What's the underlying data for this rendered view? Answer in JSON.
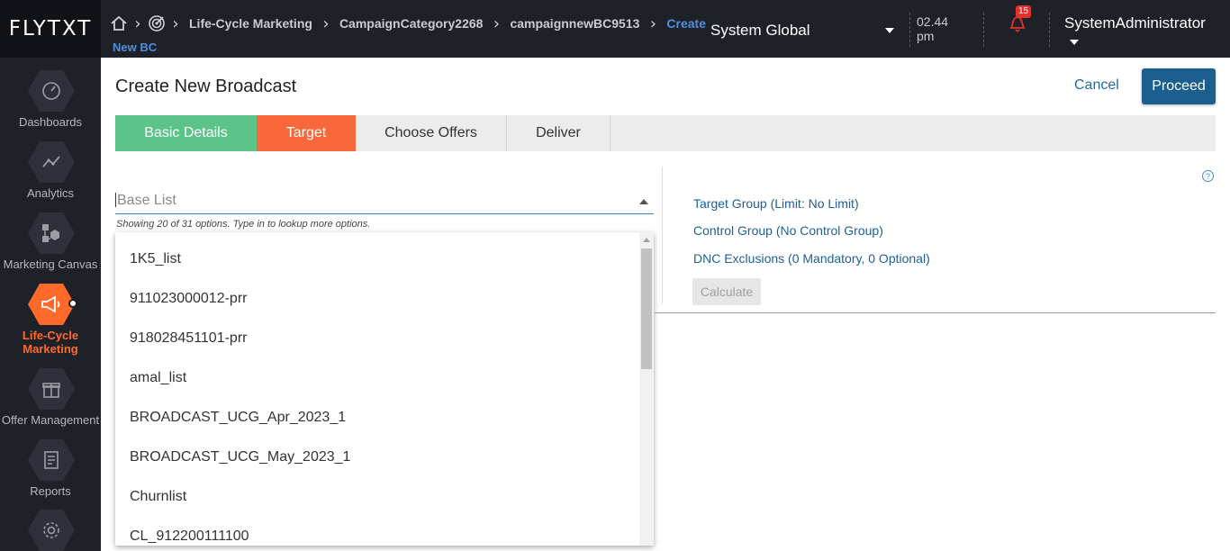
{
  "header": {
    "logo": "FLYTXT",
    "breadcrumb": [
      "Life-Cycle Marketing",
      "CampaignCategory2268",
      "campaignnewBC9513",
      "Create"
    ],
    "breadcrumb_sub": "New BC",
    "org": "System Global",
    "time": "02.44",
    "time_suffix": "pm",
    "notifications": "15",
    "user": "SystemAdministrator",
    "icons": [
      "home-icon",
      "target-icon",
      "bell-icon"
    ]
  },
  "sidebar": {
    "items": [
      {
        "label": "Dashboards",
        "icon": "gauge-icon"
      },
      {
        "label": "Analytics",
        "icon": "line-chart-icon"
      },
      {
        "label": "Marketing Canvas",
        "icon": "flow-icon"
      },
      {
        "label": "Life-Cycle Marketing",
        "line1": "Life-Cycle",
        "line2": "Marketing",
        "icon": "megaphone-icon",
        "active": true
      },
      {
        "label": "Offer Management",
        "icon": "gift-icon"
      },
      {
        "label": "Reports",
        "icon": "report-icon"
      },
      {
        "label": "",
        "icon": "gear-icon"
      }
    ]
  },
  "main": {
    "title": "Create New Broadcast",
    "cancel_label": "Cancel",
    "proceed_label": "Proceed",
    "tabs": [
      {
        "label": "Basic Details",
        "state": "done"
      },
      {
        "label": "Target",
        "state": "current"
      },
      {
        "label": "Choose Offers",
        "state": "todo"
      },
      {
        "label": "Deliver",
        "state": "todo"
      }
    ],
    "base_list": {
      "placeholder": "Base List",
      "hint": "Showing 20 of 31 options. Type in to lookup more options.",
      "options": [
        "1K5_list",
        "911023000012-prr",
        "918028451101-prr",
        "amal_list",
        "BROADCAST_UCG_Apr_2023_1",
        "BROADCAST_UCG_May_2023_1",
        "Churnlist",
        "CL_912200111100"
      ]
    },
    "target_group": "Target Group (Limit: No Limit)",
    "control_group": "Control Group (No Control Group)",
    "dnc_exclusions": "DNC Exclusions (0 Mandatory, 0 Optional)",
    "calculate_label": "Calculate",
    "help_label": "?"
  },
  "colors": {
    "header_bg": "#1f2129",
    "accent_orange": "#f8683a",
    "done_green": "#5cc389",
    "primary_blue": "#1b5f8f",
    "link_blue": "#1e5f97"
  }
}
